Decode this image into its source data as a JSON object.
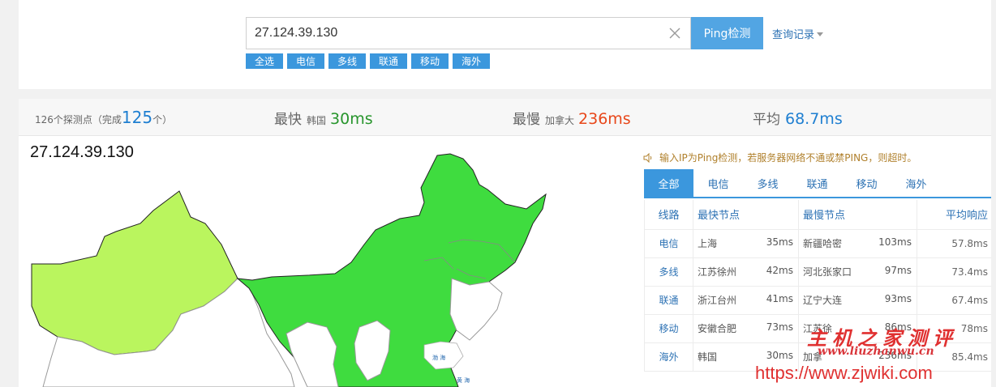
{
  "search": {
    "ip_value": "27.124.39.130",
    "ping_button": "Ping检测",
    "history_label": "查询记录",
    "chips": [
      "全选",
      "电信",
      "多线",
      "联通",
      "移动",
      "海外"
    ]
  },
  "stats": {
    "nodes_prefix": "126个探测点（完成",
    "nodes_done": "125",
    "nodes_suffix": "个）",
    "fastest_label": "最快",
    "fastest_location": "韩国",
    "fastest_value": "30ms",
    "slowest_label": "最慢",
    "slowest_location": "加拿大",
    "slowest_value": "236ms",
    "average_label": "平均",
    "average_value": "68.7ms"
  },
  "map": {
    "ip_title": "27.124.39.130",
    "sea_label_1": "渤 海",
    "sea_label_2": "黄 海",
    "region_colors": {
      "fast": "#3fdc3f",
      "medium": "#baf55e",
      "none": "#ffffff"
    }
  },
  "notice": "输入IP为Ping检测，若服务器网络不通或禁PING，则超时。",
  "tabs": [
    "全部",
    "电信",
    "多线",
    "联通",
    "移动",
    "海外"
  ],
  "table": {
    "headers": {
      "line": "线路",
      "fastest": "最快节点",
      "slowest": "最慢节点",
      "average": "平均响应"
    },
    "rows": [
      {
        "line": "电信",
        "fast_node": "上海",
        "fast_ms": "35ms",
        "slow_node": "新疆哈密",
        "slow_ms": "103ms",
        "avg": "57.8ms"
      },
      {
        "line": "多线",
        "fast_node": "江苏徐州",
        "fast_ms": "42ms",
        "slow_node": "河北张家口",
        "slow_ms": "97ms",
        "avg": "73.4ms"
      },
      {
        "line": "联通",
        "fast_node": "浙江台州",
        "fast_ms": "41ms",
        "slow_node": "辽宁大连",
        "slow_ms": "93ms",
        "avg": "67.4ms"
      },
      {
        "line": "移动",
        "fast_node": "安徽合肥",
        "fast_ms": "73ms",
        "slow_node": "江苏徐",
        "slow_ms": "86ms",
        "avg": "78ms"
      },
      {
        "line": "海外",
        "fast_node": "韩国",
        "fast_ms": "30ms",
        "slow_node": "加拿",
        "slow_ms": "236ms",
        "avg": "85.4ms"
      }
    ]
  },
  "watermark": {
    "title": "主机之家测评",
    "domain": "www.liuzhanwu.cn",
    "url": "https://www.zjwiki.com"
  }
}
